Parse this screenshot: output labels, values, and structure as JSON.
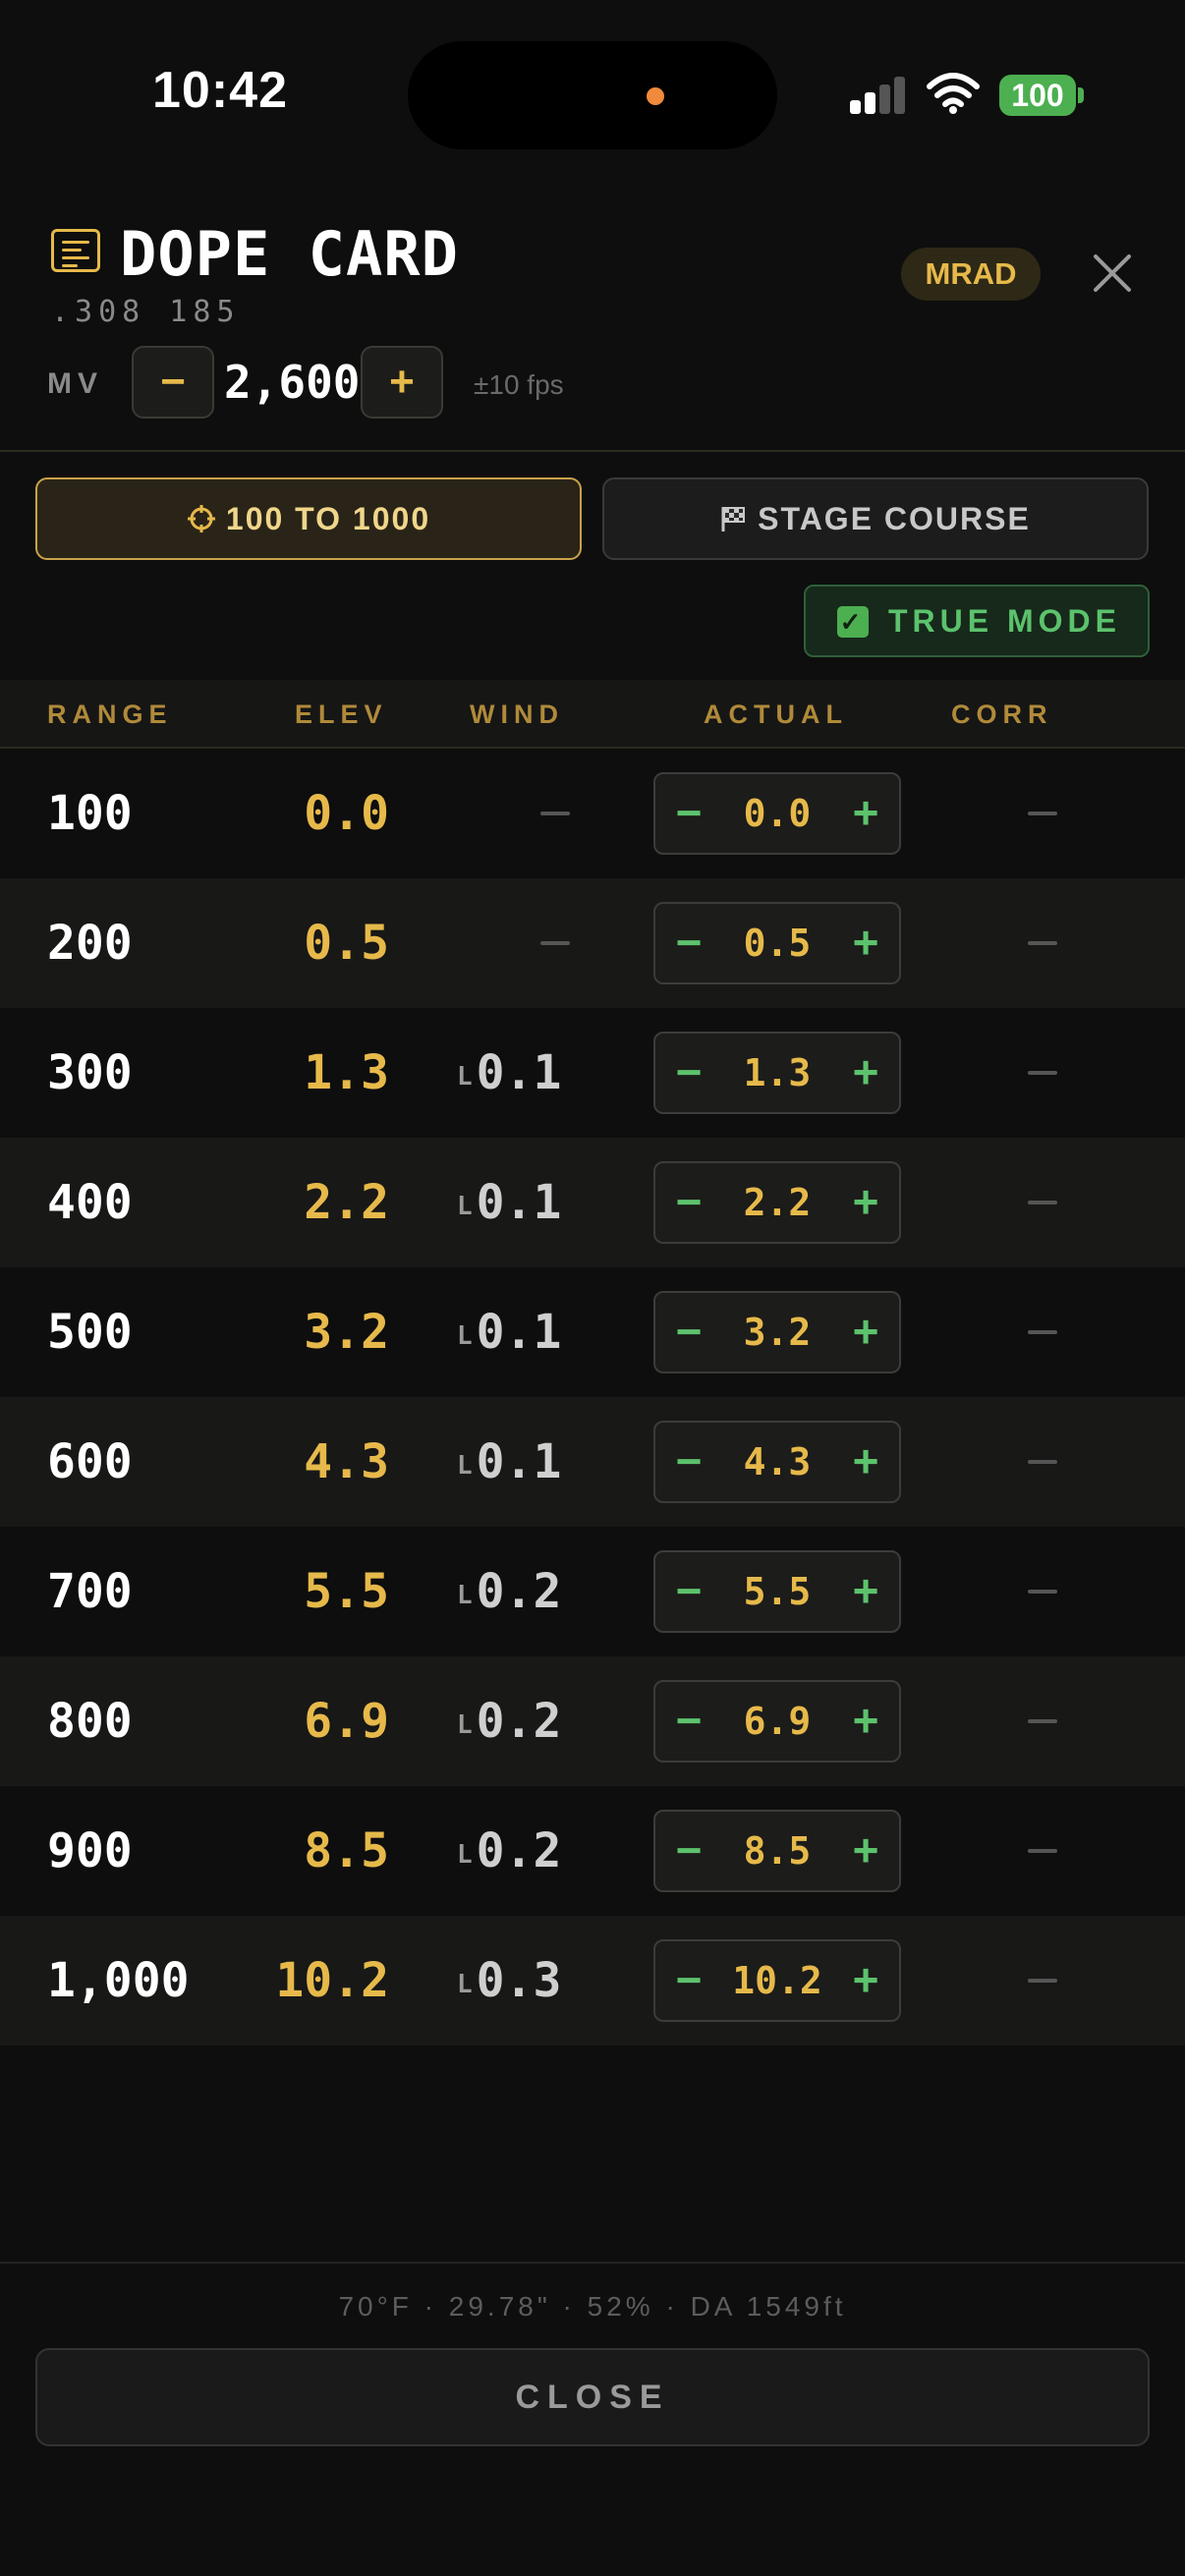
{
  "status_bar": {
    "time": "10:42",
    "battery": "100"
  },
  "header": {
    "title": "DOPE CARD",
    "subtitle": ".308 185",
    "unit_badge": "MRAD",
    "mv": {
      "label": "MV",
      "value": "2,600",
      "minus": "−",
      "plus": "+",
      "note": "±10 fps"
    }
  },
  "modes": {
    "range_mode": "100 TO 1000",
    "stage_mode": "STAGE COURSE",
    "true_mode": "TRUE MODE",
    "true_mode_checked": true
  },
  "table": {
    "headers": [
      "RANGE",
      "ELEV",
      "WIND",
      "ACTUAL",
      "CORR"
    ],
    "rows": [
      {
        "range": "100",
        "elev": "0.0",
        "wind_dir": "",
        "wind": "",
        "actual": "0.0",
        "corr": ""
      },
      {
        "range": "200",
        "elev": "0.5",
        "wind_dir": "",
        "wind": "",
        "actual": "0.5",
        "corr": ""
      },
      {
        "range": "300",
        "elev": "1.3",
        "wind_dir": "L",
        "wind": "0.1",
        "actual": "1.3",
        "corr": ""
      },
      {
        "range": "400",
        "elev": "2.2",
        "wind_dir": "L",
        "wind": "0.1",
        "actual": "2.2",
        "corr": ""
      },
      {
        "range": "500",
        "elev": "3.2",
        "wind_dir": "L",
        "wind": "0.1",
        "actual": "3.2",
        "corr": ""
      },
      {
        "range": "600",
        "elev": "4.3",
        "wind_dir": "L",
        "wind": "0.1",
        "actual": "4.3",
        "corr": ""
      },
      {
        "range": "700",
        "elev": "5.5",
        "wind_dir": "L",
        "wind": "0.2",
        "actual": "5.5",
        "corr": ""
      },
      {
        "range": "800",
        "elev": "6.9",
        "wind_dir": "L",
        "wind": "0.2",
        "actual": "6.9",
        "corr": ""
      },
      {
        "range": "900",
        "elev": "8.5",
        "wind_dir": "L",
        "wind": "0.2",
        "actual": "8.5",
        "corr": ""
      },
      {
        "range": "1,000",
        "elev": "10.2",
        "wind_dir": "L",
        "wind": "0.3",
        "actual": "10.2",
        "corr": ""
      }
    ]
  },
  "footer": {
    "conditions": "70°F · 29.78\" · 52% · DA 1549ft",
    "close_label": "CLOSE"
  },
  "colors": {
    "accent_gold": "#e6b94a",
    "accent_green": "#5cc26c",
    "background": "#0e0e0e"
  },
  "icons": [
    "document-icon",
    "close-icon",
    "crosshair-icon",
    "flag-icon",
    "checkbox-icon",
    "signal-icon",
    "wifi-icon",
    "battery-icon"
  ]
}
